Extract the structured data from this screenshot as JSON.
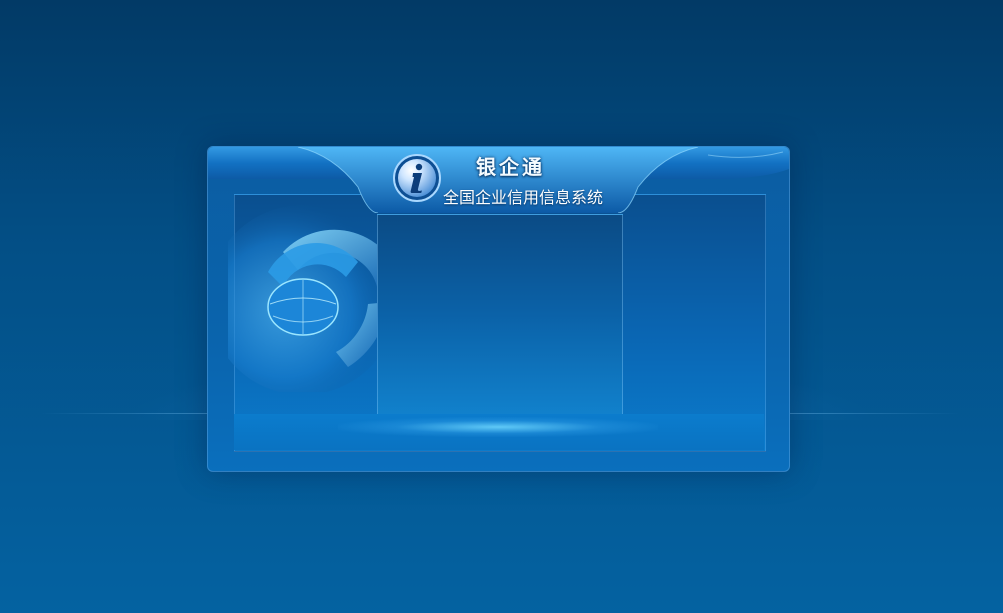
{
  "app": {
    "title": "银企通",
    "subtitle": "全国企业信用信息系统"
  },
  "icons": {
    "info": "info-icon",
    "graphic": "abstract-globe-graphic"
  },
  "colors": {
    "background_top": "#023a66",
    "background_bottom": "#0462a1",
    "frame": "#0a64ad",
    "accent_glow": "#6ed7ff"
  }
}
